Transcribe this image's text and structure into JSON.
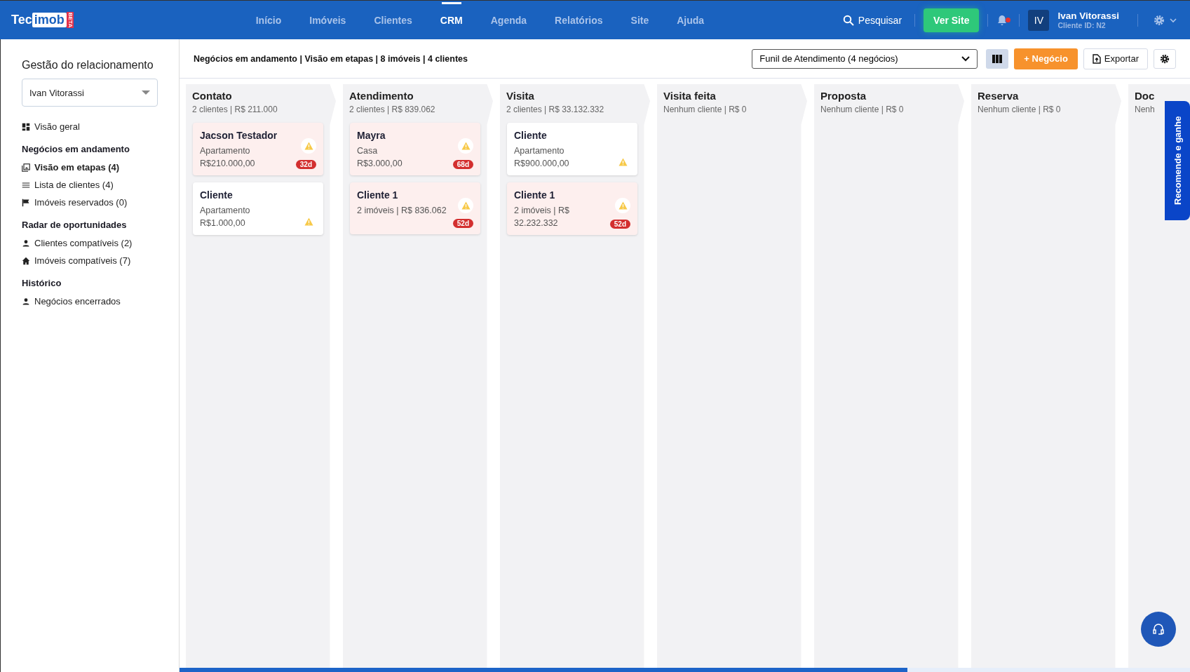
{
  "header": {
    "logo": {
      "left": "Tec",
      "right": "imob",
      "tag": "BETA"
    },
    "nav": [
      {
        "label": "Início",
        "selected": false
      },
      {
        "label": "Imóveis",
        "selected": false
      },
      {
        "label": "Clientes",
        "selected": false
      },
      {
        "label": "CRM",
        "selected": true
      },
      {
        "label": "Agenda",
        "selected": false
      },
      {
        "label": "Relatórios",
        "selected": false
      },
      {
        "label": "Site",
        "selected": false
      },
      {
        "label": "Ajuda",
        "selected": false
      }
    ],
    "search": "Pesquisar",
    "site_button": "Ver Site",
    "notification_dot": true,
    "user": {
      "initials": "IV",
      "name": "Ivan Vitorassi",
      "client_id": "Cliente ID: N2"
    }
  },
  "sidebar": {
    "title": "Gestão do relacionamento",
    "user_select": "Ivan Vitorassi",
    "sections": [
      {
        "items": [
          {
            "label": "Visão geral",
            "selected": false
          }
        ]
      },
      {
        "heading": "Negócios em andamento",
        "items": [
          {
            "label": "Visão em etapas (4)",
            "selected": true
          },
          {
            "label": "Lista de clientes (4)",
            "selected": false
          },
          {
            "label": "Imóveis reservados (0)",
            "selected": false
          }
        ]
      },
      {
        "heading": "Radar de oportunidades",
        "items": [
          {
            "label": "Clientes compatíveis (2)",
            "selected": false
          },
          {
            "label": "Imóveis compatíveis (7)",
            "selected": false
          }
        ]
      },
      {
        "heading": "Histórico",
        "items": [
          {
            "label": "Negócios encerrados",
            "selected": false
          }
        ]
      }
    ]
  },
  "toolbar": {
    "summary": "Negócios em andamento | Visão em etapas | 8 imóveis | 4 clientes",
    "funnel": "Funil de Atendimento (4 negócios)",
    "new_button": "+ Negócio",
    "export_button": "Exportar"
  },
  "board": {
    "stages": [
      {
        "title": "Contato",
        "subtitle": "2 clientes | R$ 211.000",
        "cards": [
          {
            "name": "Jacson Testador",
            "lines": [
              "Apartamento",
              "R$210.000,00"
            ],
            "overdue": true,
            "badge": "32d"
          },
          {
            "name": "Cliente",
            "lines": [
              "Apartamento",
              "R$1.000,00"
            ],
            "overdue": false
          }
        ]
      },
      {
        "title": "Atendimento",
        "subtitle": "2 clientes | R$ 839.062",
        "cards": [
          {
            "name": "Mayra",
            "lines": [
              "Casa",
              "R$3.000,00"
            ],
            "overdue": true,
            "badge": "68d"
          },
          {
            "name": "Cliente 1",
            "lines": [
              "2 imóveis | R$ 836.062"
            ],
            "overdue": true,
            "badge": "52d"
          }
        ]
      },
      {
        "title": "Visita",
        "subtitle": "2 clientes | R$ 33.132.332",
        "cards": [
          {
            "name": "Cliente",
            "lines": [
              "Apartamento",
              "R$900.000,00"
            ],
            "overdue": false
          },
          {
            "name": "Cliente 1",
            "lines": [
              "2 imóveis | R$",
              "32.232.332"
            ],
            "overdue": true,
            "badge": "52d"
          }
        ]
      },
      {
        "title": "Visita feita",
        "subtitle": "Nenhum cliente | R$ 0"
      },
      {
        "title": "Proposta",
        "subtitle": "Nenhum cliente | R$ 0"
      },
      {
        "title": "Reserva",
        "subtitle": "Nenhum cliente | R$ 0"
      },
      {
        "title": "Doc",
        "subtitle": "Nenh"
      }
    ]
  },
  "referral_tab": "Recomende e ganhe"
}
